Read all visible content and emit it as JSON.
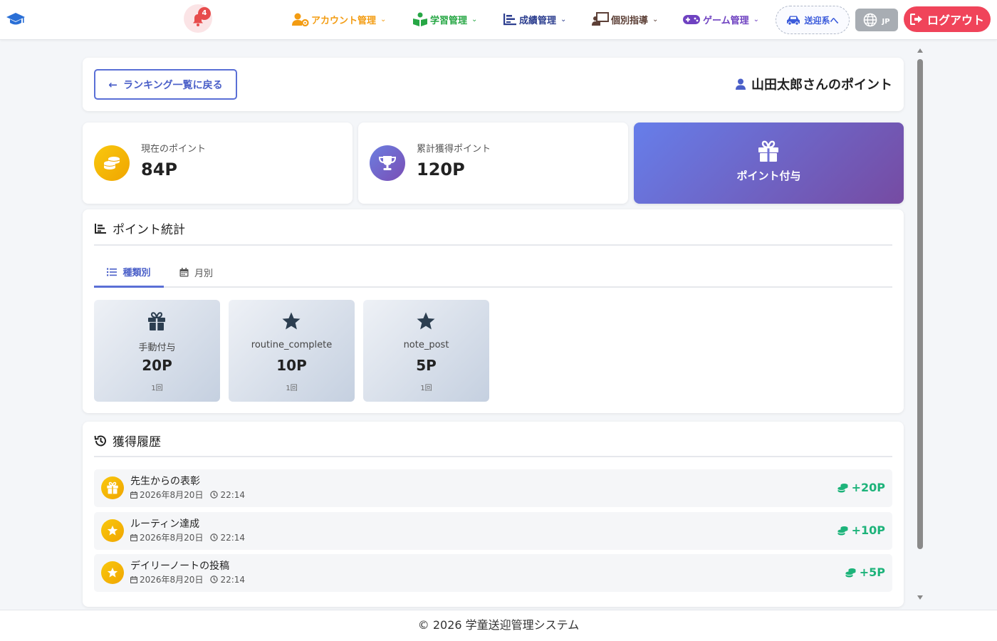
{
  "navbar": {
    "notification_count": "4",
    "menus": [
      {
        "label": "アカウント管理",
        "icon": "user-gear-icon",
        "color": "#f39c12"
      },
      {
        "label": "学習管理",
        "icon": "book-reader-icon",
        "color": "#27a745"
      },
      {
        "label": "成績管理",
        "icon": "chart-bar-icon",
        "color": "#2c3e8f"
      },
      {
        "label": "個別指導",
        "icon": "chalkboard-teacher-icon",
        "color": "#5d4037"
      },
      {
        "label": "ゲーム管理",
        "icon": "gamepad-icon",
        "color": "#6f42c1"
      }
    ],
    "pickup_label": "送迎系へ",
    "lang_label": "JP",
    "logout_label": "ログアウト"
  },
  "header": {
    "back_label": "ランキング一覧に戻る",
    "title": "山田太郎さんのポイント"
  },
  "stats": {
    "current": {
      "label": "現在のポイント",
      "value": "84P"
    },
    "total": {
      "label": "累計獲得ポイント",
      "value": "120P"
    },
    "award_label": "ポイント付与"
  },
  "point_stats": {
    "title": "ポイント統計",
    "tabs": [
      {
        "label": "種類別",
        "active": true
      },
      {
        "label": "月別",
        "active": false
      }
    ],
    "types": [
      {
        "name": "手動付与",
        "points": "20P",
        "count": "1回",
        "icon": "gift-icon"
      },
      {
        "name": "routine_complete",
        "points": "10P",
        "count": "1回",
        "icon": "star-icon"
      },
      {
        "name": "note_post",
        "points": "5P",
        "count": "1回",
        "icon": "star-icon"
      }
    ]
  },
  "history": {
    "title": "獲得履歴",
    "items": [
      {
        "title": "先生からの表彰",
        "date": "2026年8月20日",
        "time": "22:14",
        "points": "+20P",
        "icon": "gift-icon"
      },
      {
        "title": "ルーティン達成",
        "date": "2026年8月20日",
        "time": "22:14",
        "points": "+10P",
        "icon": "star-icon"
      },
      {
        "title": "デイリーノートの投稿",
        "date": "2026年8月20日",
        "time": "22:14",
        "points": "+5P",
        "icon": "star-icon"
      }
    ]
  },
  "footer": {
    "copyright": "© 2026 学童送迎管理システム"
  },
  "colors": {
    "accent": "#5a6fd6",
    "logout": "#f0445a",
    "points_green": "#1db37a",
    "award_gradient": [
      "#667eea",
      "#764ba2"
    ]
  }
}
